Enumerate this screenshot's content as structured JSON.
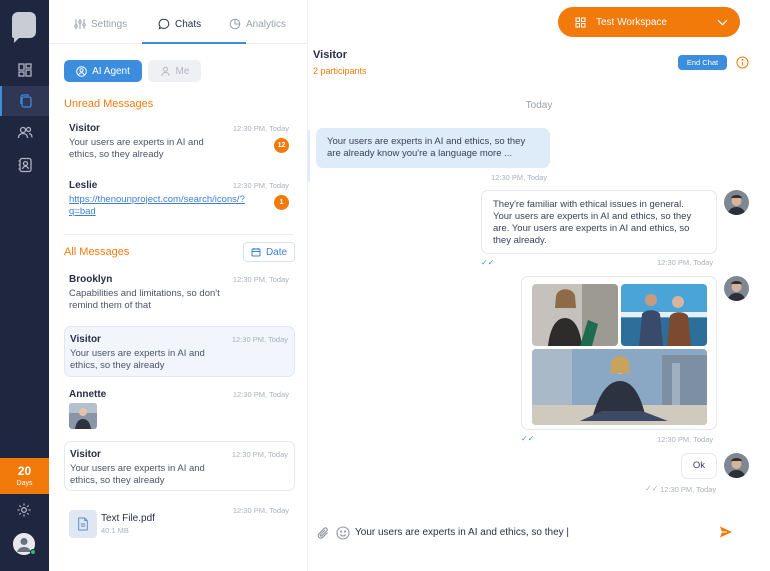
{
  "sidebar": {
    "nav_icons": [
      "dashboard-icon",
      "chats-icon",
      "users-icon",
      "contacts-icon"
    ],
    "trial": {
      "days": "20",
      "label": "Days"
    }
  },
  "tabs": [
    {
      "label": "Settings",
      "icon": "sliders-icon"
    },
    {
      "label": "Chats",
      "icon": "chat-bubble-icon",
      "active": true
    },
    {
      "label": "Analytics",
      "icon": "pie-chart-icon"
    }
  ],
  "filters": {
    "agent": "AI Agent",
    "me": "Me"
  },
  "unread": {
    "title": "Unread Messages",
    "items": [
      {
        "name": "Visitor",
        "time": "12:30 PM, Today",
        "preview": "Your users are experts in AI and ethics, so they already",
        "badge": "12"
      },
      {
        "name": "Leslie",
        "time": "12:30 PM, Today",
        "preview": "https://thenounproject.com/search/icons/?q=bad",
        "badge": "1"
      }
    ]
  },
  "all": {
    "title": "All Messages",
    "date_button": "Date",
    "items": [
      {
        "name": "Brooklyn",
        "time": "12:30 PM, Today",
        "preview": "Capabilities and limitations, so don't remind them of that"
      },
      {
        "name": "Visitor",
        "time": "12:30 PM, Today",
        "preview": "Your users are experts in AI and ethics, so they already"
      },
      {
        "name": "Annette",
        "time": "12:30 PM, Today"
      },
      {
        "name": "Visitor",
        "time": "12:30 PM, Today",
        "preview": "Your users are experts in AI and ethics, so they already"
      },
      {
        "time": "12:30 PM, Today",
        "file_name": "Text File.pdf",
        "file_size": "40.1 MB"
      }
    ]
  },
  "workspace": {
    "label": "Test Workspace"
  },
  "chat": {
    "title": "Visitor",
    "subtitle": "2 participants",
    "end_chat": "End Chat",
    "day_separator": "Today",
    "messages": [
      {
        "text": "Your users are experts in AI and ethics, so they are already know you're a language more ...",
        "time": "12:30 PM, Today"
      },
      {
        "text": "They're familiar with ethical issues in general. Your users are experts in AI and ethics, so they are. Your users are experts in AI and ethics, so they already.",
        "time": "12:30 PM, Today"
      },
      {
        "time": "12:30 PM, Today"
      },
      {
        "text": "Ok",
        "time": "12:30 PM, Today"
      }
    ],
    "composer_text": "Your users are experts in AI and ethics, so they |"
  },
  "colors": {
    "accent": "#f27a0b",
    "primary": "#3d8ddf",
    "sidebar": "#1f2640"
  }
}
